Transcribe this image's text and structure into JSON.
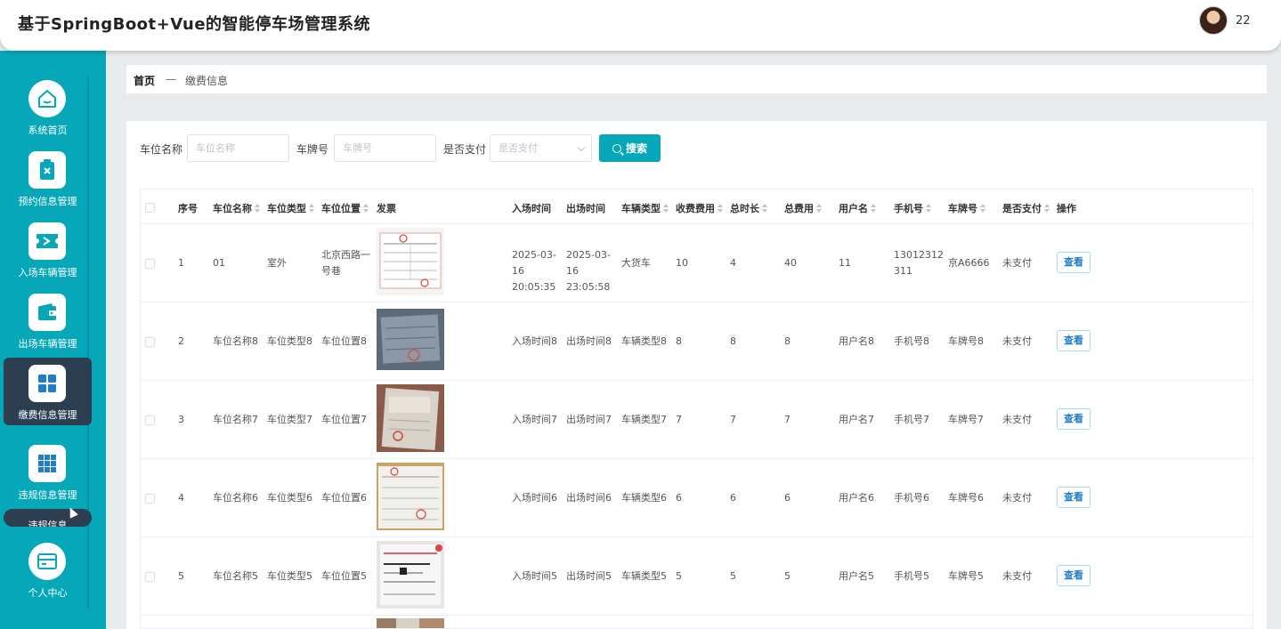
{
  "header": {
    "title": "基于SpringBoot+Vue的智能停车场管理系统",
    "username": "22"
  },
  "sidebar": {
    "items": [
      {
        "label": "系统首页",
        "icon": "home-icon"
      },
      {
        "label": "预约信息管理",
        "icon": "clipboard-icon"
      },
      {
        "label": "入场车辆管理",
        "icon": "ticket-icon"
      },
      {
        "label": "出场车辆管理",
        "icon": "wallet-icon"
      },
      {
        "label": "缴费信息管理",
        "icon": "grid-icon"
      },
      {
        "label": "违规信息管理",
        "icon": "apps-icon"
      },
      {
        "label": "个人中心",
        "icon": "card-icon"
      }
    ],
    "sub_item": "违规信息",
    "accent": "#06a7b8",
    "active_bg": "#2c3e50"
  },
  "breadcrumb": {
    "home": "首页",
    "separator": "—",
    "current": "缴费信息"
  },
  "search": {
    "space_name_label": "车位名称",
    "space_name_placeholder": "车位名称",
    "plate_label": "车牌号",
    "plate_placeholder": "车牌号",
    "paid_label": "是否支付",
    "paid_placeholder": "是否支付",
    "button": "搜索"
  },
  "table": {
    "headers": [
      "序号",
      "车位名称",
      "车位类型",
      "车位位置",
      "发票",
      "入场时间",
      "出场时间",
      "车辆类型",
      "收费费用",
      "总时长",
      "总费用",
      "用户名",
      "手机号",
      "车牌号",
      "是否支付",
      "操作"
    ],
    "rows": [
      {
        "no": "1",
        "name": "01",
        "type": "室外",
        "loc": "北京西路一号巷",
        "in": "2025-03-16 20:05:35",
        "out": "2025-03-16 23:05:58",
        "vtype": "大货车",
        "fee": "10",
        "dur": "4",
        "total": "40",
        "user": "11",
        "phone": "13012312311",
        "plate": "京A6666",
        "paid": "未支付",
        "action": "查看"
      },
      {
        "no": "2",
        "name": "车位名称8",
        "type": "车位类型8",
        "loc": "车位位置8",
        "in": "入场时间8",
        "out": "出场时间8",
        "vtype": "车辆类型8",
        "fee": "8",
        "dur": "8",
        "total": "8",
        "user": "用户名8",
        "phone": "手机号8",
        "plate": "车牌号8",
        "paid": "未支付",
        "action": "查看"
      },
      {
        "no": "3",
        "name": "车位名称7",
        "type": "车位类型7",
        "loc": "车位位置7",
        "in": "入场时间7",
        "out": "出场时间7",
        "vtype": "车辆类型7",
        "fee": "7",
        "dur": "7",
        "total": "7",
        "user": "用户名7",
        "phone": "手机号7",
        "plate": "车牌号7",
        "paid": "未支付",
        "action": "查看"
      },
      {
        "no": "4",
        "name": "车位名称6",
        "type": "车位类型6",
        "loc": "车位位置6",
        "in": "入场时间6",
        "out": "出场时间6",
        "vtype": "车辆类型6",
        "fee": "6",
        "dur": "6",
        "total": "6",
        "user": "用户名6",
        "phone": "手机号6",
        "plate": "车牌号6",
        "paid": "未支付",
        "action": "查看"
      },
      {
        "no": "5",
        "name": "车位名称5",
        "type": "车位类型5",
        "loc": "车位位置5",
        "in": "入场时间5",
        "out": "出场时间5",
        "vtype": "车辆类型5",
        "fee": "5",
        "dur": "5",
        "total": "5",
        "user": "用户名5",
        "phone": "手机号5",
        "plate": "车牌号5",
        "paid": "未支付",
        "action": "查看"
      }
    ]
  }
}
